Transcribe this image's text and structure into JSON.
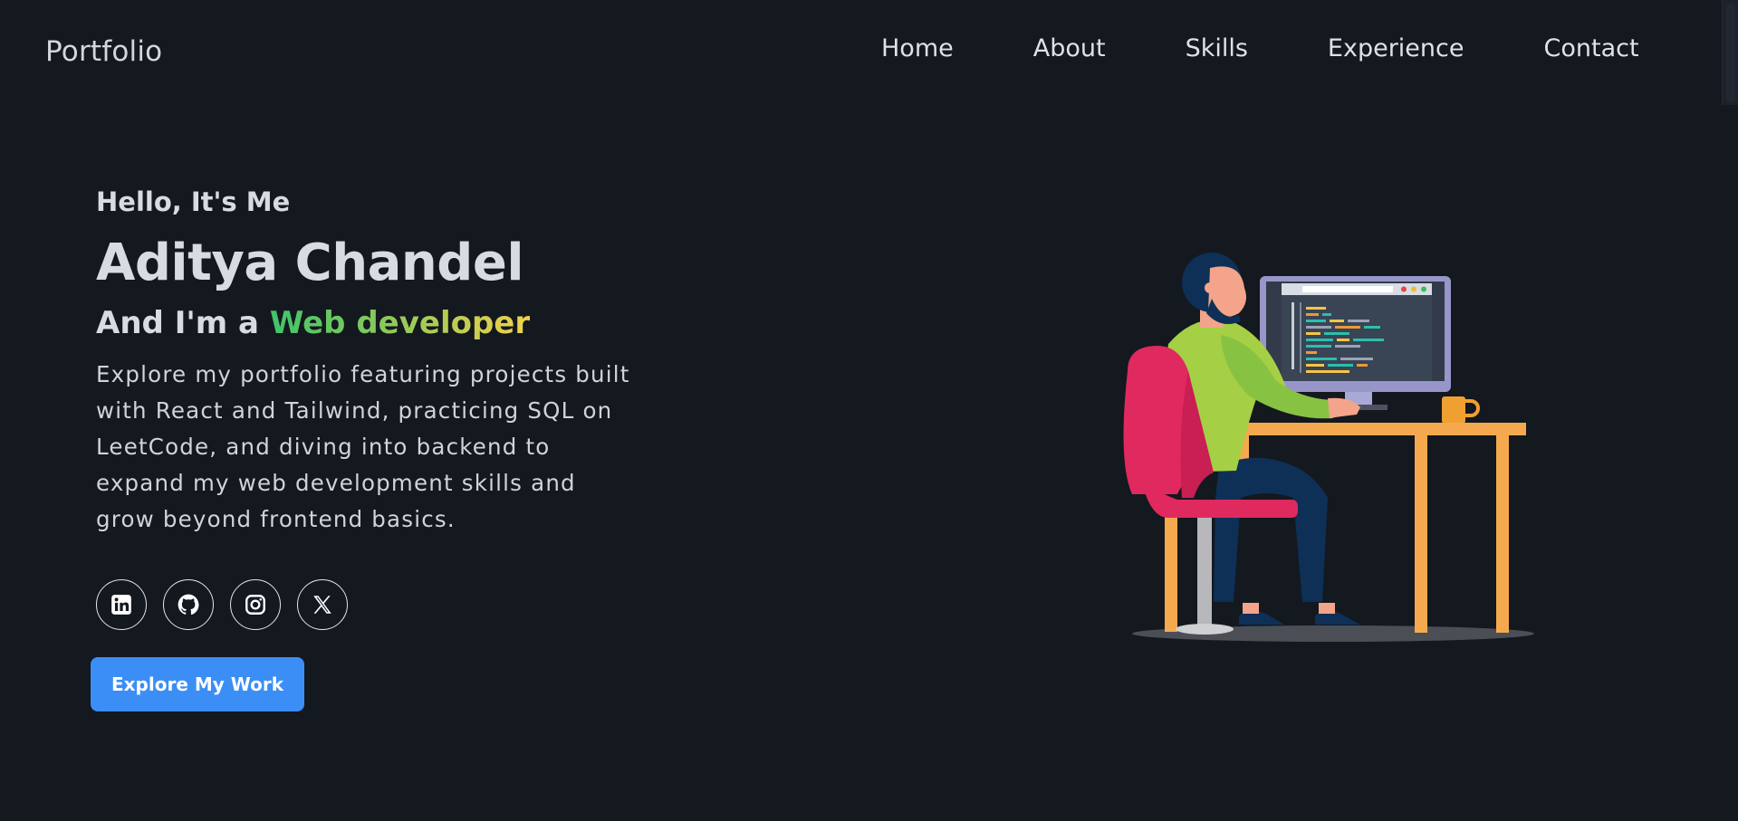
{
  "header": {
    "brand": "Portfolio",
    "nav": [
      {
        "label": "Home"
      },
      {
        "label": "About"
      },
      {
        "label": "Skills"
      },
      {
        "label": "Experience"
      },
      {
        "label": "Contact"
      }
    ]
  },
  "hero": {
    "greeting": "Hello, It's Me",
    "name": "Aditya Chandel",
    "role_prefix": "And I'm a ",
    "role": "Web developer",
    "bio": "Explore my portfolio featuring projects built with React and Tailwind, practicing SQL on LeetCode, and diving into backend to expand my web development skills and grow beyond frontend basics.",
    "socials": [
      {
        "icon": "linkedin-icon"
      },
      {
        "icon": "github-icon"
      },
      {
        "icon": "instagram-icon"
      },
      {
        "icon": "x-icon"
      }
    ],
    "cta_label": "Explore My Work"
  },
  "colors": {
    "background": "#14181f",
    "accent": "#3b8ef5",
    "gradient_start": "#3fc46b",
    "gradient_end": "#f1d24a"
  }
}
